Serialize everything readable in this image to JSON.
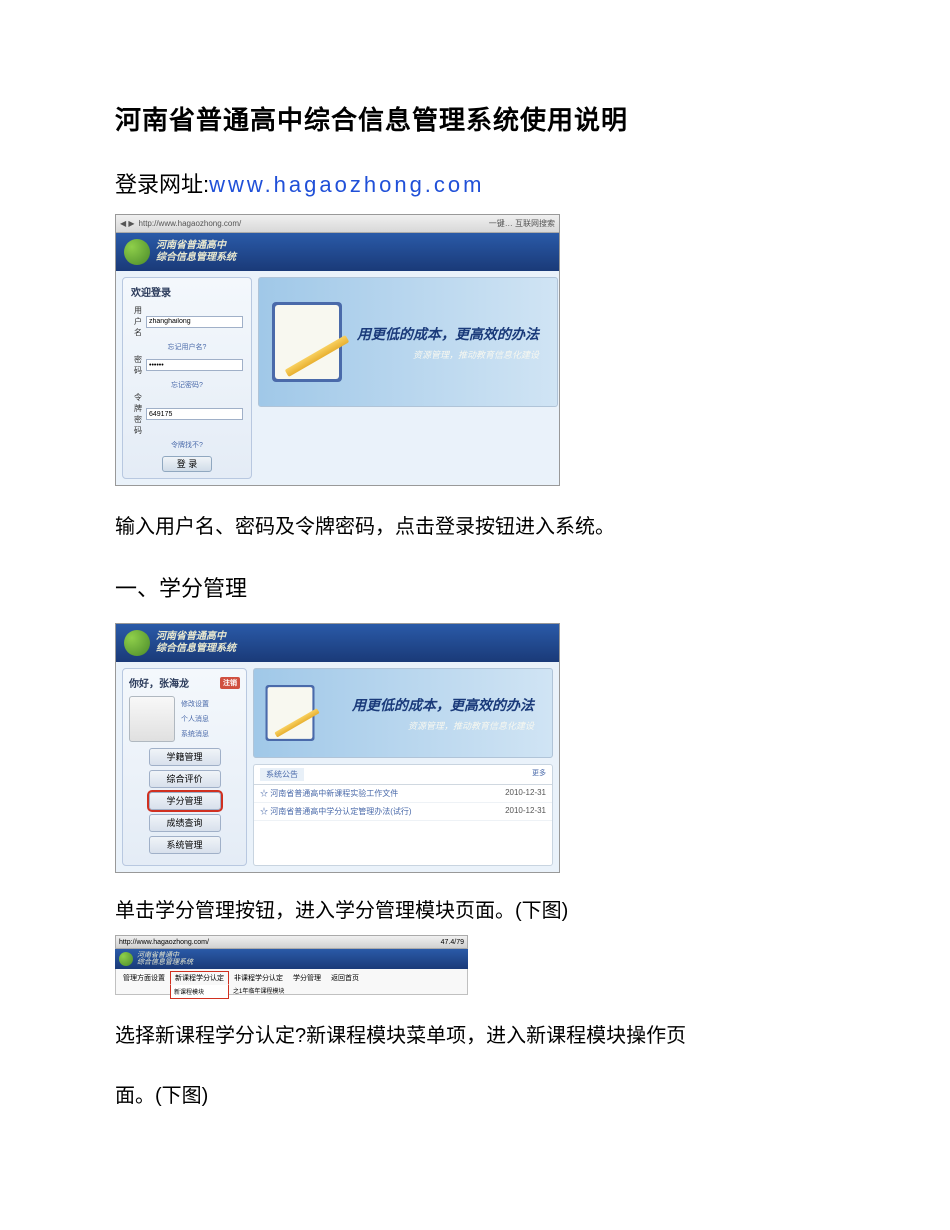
{
  "title": "河南省普通高中综合信息管理系统使用说明",
  "loginUrl": {
    "label": "登录网址:",
    "url": "www.hagaozhong.com"
  },
  "screenshot1": {
    "browserUrl": "http://www.hagaozhong.com/",
    "browserRight": "一键… 互联网搜索",
    "appTitle1": "河南省普通高中",
    "appTitle2": "综合信息管理系统",
    "loginPanelTitle": "欢迎登录",
    "usernameLabel": "用 户 名",
    "usernameValue": "zhanghailong",
    "usernameLink": "忘记用户名?",
    "passwordLabel": "密    码",
    "passwordValue": "******",
    "passwordLink": "忘记密码?",
    "tokenLabel": "令牌密码",
    "tokenValue": "649175",
    "tokenLink": "令牌找不?",
    "loginBtn": "登 录",
    "slogan": "用更低的成本，更高效的办法",
    "subSlogan": "资源管理，推动教育信息化建设"
  },
  "instruction1": "输入用户名、密码及令牌密码，点击登录按钮进入系统。",
  "section1Title": "一、学分管理",
  "screenshot2": {
    "greeting": "你好，张海龙",
    "logout": "注销",
    "userLink1": "修改设置",
    "userLink2": "个人消息",
    "userLink3": "系统消息",
    "menu1": "学籍管理",
    "menu2": "综合评价",
    "menu3": "学分管理",
    "menu4": "成绩查询",
    "menu5": "系统管理",
    "noticeTab": "系统公告",
    "noticeMore": "更多",
    "notice1Text": "河南省普通高中新课程实验工作文件",
    "notice1Date": "2010-12-31",
    "notice2Text": "河南省普通高中学分认定管理办法(试行)",
    "notice2Date": "2010-12-31"
  },
  "instruction2": "单击学分管理按钮，进入学分管理模块页面。(下图)",
  "screenshot3": {
    "browserUrl": "http://www.hagaozhong.com/",
    "browserRight": "47.4/79",
    "appTitle1": "河南省普通中",
    "appTitle2": "综合信息管理系统",
    "menuItem1": "管理方面设置",
    "menuItem2": "新课程学分认定",
    "menuSub1": "新课程模块",
    "menuItem3": "非课程学分认定",
    "menuSub3": "之1年临年课程模块",
    "menuItem4": "学分管理",
    "menuItem5": "返回首页"
  },
  "instruction3a": "选择新课程学分认定?新课程模块菜单项，进入新课程模块操作页",
  "instruction3b": "面。(下图)"
}
